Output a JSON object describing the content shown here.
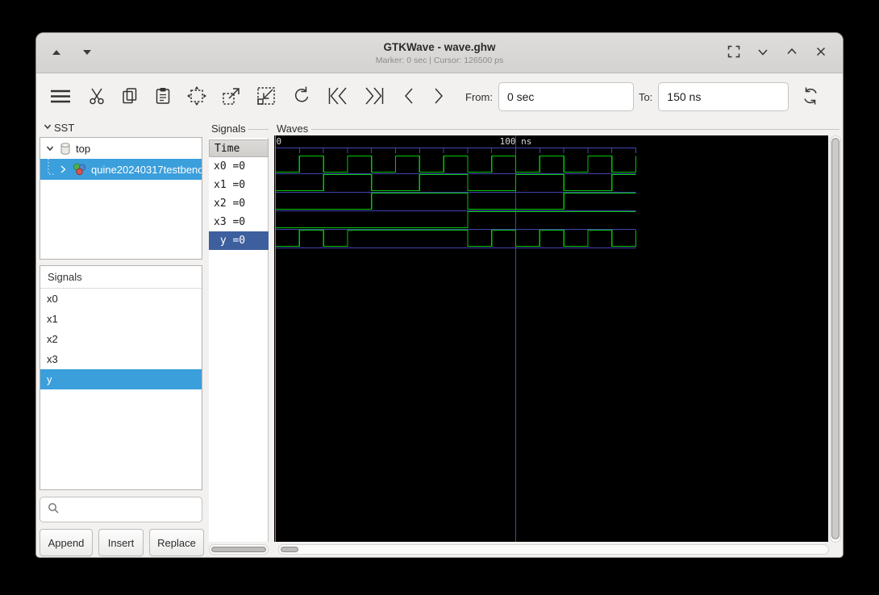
{
  "window": {
    "title": "GTKWave - wave.ghw",
    "status": "Marker: 0 sec  |  Cursor: 126500 ps"
  },
  "titlebar_icons": [
    "shift-up",
    "shift-down",
    "fullscreen",
    "minimize",
    "maximize",
    "close"
  ],
  "toolbar": {
    "icons": [
      "menu",
      "cut",
      "copy",
      "paste",
      "zoom-fit",
      "zoom-in",
      "zoom-out",
      "undo",
      "skip-to-start",
      "skip-to-end",
      "step-back",
      "step-forward",
      "reload"
    ],
    "from_label": "From:",
    "from_value": "0 sec",
    "to_label": "To:",
    "to_value": "150 ns"
  },
  "sst": {
    "label": "SST",
    "tree": [
      {
        "label": "top",
        "icon": "cylinder-icon",
        "expanded": true
      },
      {
        "label": "quine20240317testbenc",
        "icon": "module-icon",
        "selected": true
      }
    ]
  },
  "signal_list": {
    "header": "Signals",
    "items": [
      "x0",
      "x1",
      "x2",
      "x3",
      "y"
    ],
    "selected": "y"
  },
  "actions": {
    "append": "Append",
    "insert": "Insert",
    "replace": "Replace"
  },
  "names_panel": {
    "label": "Signals",
    "header": "Time",
    "rows": [
      {
        "text": "x0 =0"
      },
      {
        "text": "x1 =0"
      },
      {
        "text": "x2 =0"
      },
      {
        "text": "x3 =0"
      },
      {
        "text": " y =0",
        "selected": true
      }
    ]
  },
  "waves_panel": {
    "label": "Waves"
  },
  "colors": {
    "selection_blue": "#3b9fdc",
    "selection_dark_blue": "#3e5f9e",
    "wave_green": "#00c800",
    "wave_blue": "#4444b0",
    "marker_red": "#c96a6a",
    "canvas_black": "#000000",
    "timeline_text": "#d9d9d9"
  },
  "chart_data": {
    "type": "digital-waveform",
    "title": "Waves",
    "time_unit": "ns",
    "t_start": 0,
    "t_end": 150,
    "tick_interval_ns": 10,
    "tick_label_start": "0",
    "tick_label_major": "100 ns",
    "major_grid_ns": 100,
    "marker_time_ns": 0,
    "cursor_time_ps": 126500,
    "signals": [
      {
        "name": "x0",
        "initial": 0,
        "toggles": [
          10,
          20,
          30,
          40,
          50,
          60,
          70,
          80,
          90,
          100,
          110,
          120,
          130,
          140,
          150
        ]
      },
      {
        "name": "x1",
        "initial": 0,
        "toggles": [
          20,
          40,
          60,
          80,
          100,
          120,
          140
        ]
      },
      {
        "name": "x2",
        "initial": 0,
        "toggles": [
          40,
          80,
          120
        ]
      },
      {
        "name": "x3",
        "initial": 0,
        "toggles": [
          80
        ]
      },
      {
        "name": "y",
        "initial": 0,
        "toggles": [
          10,
          20,
          30,
          80,
          90,
          100,
          110,
          120,
          130,
          140,
          150
        ]
      }
    ]
  }
}
